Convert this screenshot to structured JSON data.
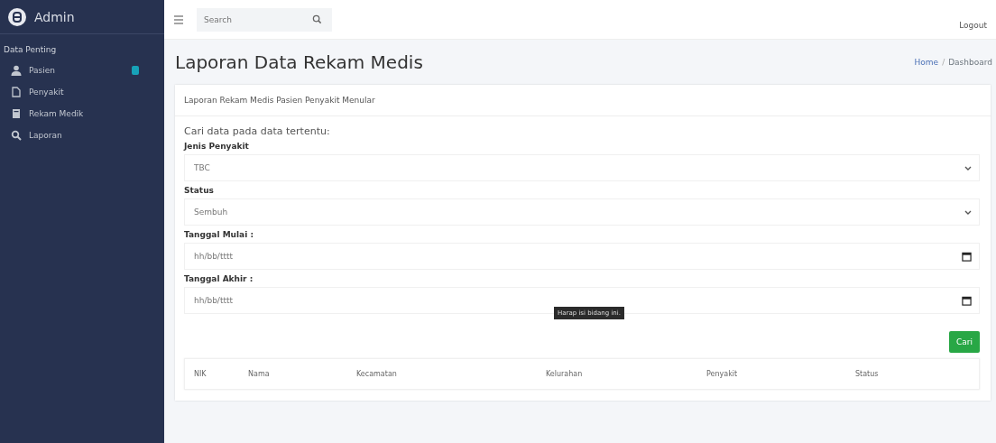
{
  "sidebar": {
    "brand": "Admin",
    "section": "Data Penting",
    "items": [
      {
        "label": "Pasien",
        "badge": true,
        "selected": false
      },
      {
        "label": "Penyakit",
        "badge": false,
        "selected": false
      },
      {
        "label": "Rekam Medik",
        "badge": false,
        "selected": false
      },
      {
        "label": "Laporan",
        "badge": false,
        "selected": false
      }
    ]
  },
  "topbar": {
    "search": {
      "placeholder": "Search"
    },
    "logout": "Logout"
  },
  "page": {
    "title": "Laporan Data Rekam Medis",
    "breadcrumb": [
      "Home",
      "Dashboard"
    ],
    "breadcrumb_separator": "/"
  },
  "card": {
    "title": "Laporan Rekam Medis Pasien Penyakit Menular",
    "intro": "Cari data pada data tertentu:",
    "fields": [
      {
        "kind": "select",
        "label": "Jenis Penyakit",
        "value": "TBC"
      },
      {
        "kind": "select",
        "label": "Status",
        "value": "Sembuh"
      },
      {
        "kind": "date",
        "label": "Tanggal Mulai :",
        "placeholder": "hh/bb/tttt"
      },
      {
        "kind": "date",
        "label": "Tanggal Akhir :",
        "placeholder": "hh/bb/tttt"
      }
    ],
    "tooltip": "Harap isi bidang ini.",
    "button": "Cari",
    "table": {
      "columns": [
        "NIK",
        "Nama",
        "Kecamatan",
        "Kelurahan",
        "Penyakit",
        "Status"
      ]
    }
  }
}
